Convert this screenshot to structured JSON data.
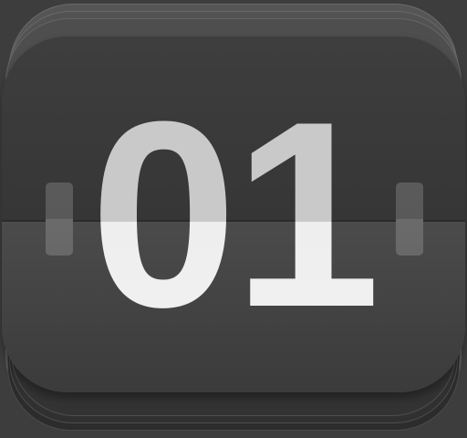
{
  "icon": {
    "digits": "01",
    "name": "flip-clock-app-icon"
  },
  "colors": {
    "card_upper": "#3c3c3c",
    "card_lower": "#4a4a4a",
    "digit_upper": "#c9c9c9",
    "digit_lower": "#eeeeee"
  }
}
